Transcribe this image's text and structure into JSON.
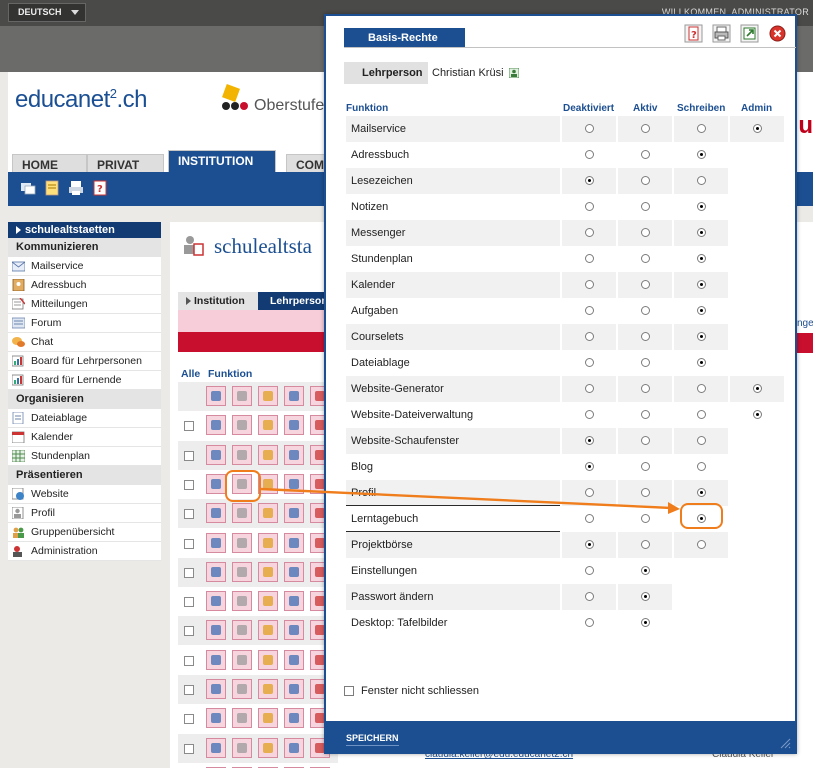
{
  "topbar": {
    "language": "DEUTSCH",
    "welcome": "WILLKOMMEN, ADMINISTRATOR"
  },
  "header": {
    "logo_main": "educanet",
    "logo_sup": "2",
    "logo_suffix": ".ch",
    "school": "Oberstufe",
    "edge_text": "u"
  },
  "nav": {
    "tabs": [
      "HOME",
      "PRIVAT",
      "INSTITUTION",
      "COM"
    ],
    "active": "INSTITUTION"
  },
  "sidebar": {
    "head": "schulealtstaetten",
    "sections": [
      {
        "title": "Kommunizieren",
        "items": [
          "Mailservice",
          "Adressbuch",
          "Mitteilungen",
          "Forum",
          "Chat",
          "Board für Lehrpersonen",
          "Board für Lernende"
        ]
      },
      {
        "title": "Organisieren",
        "items": [
          "Dateiablage",
          "Kalender",
          "Stundenplan"
        ]
      },
      {
        "title": "Präsentieren",
        "items": [
          "Website",
          "Profil",
          "Gruppenübersicht",
          "Administration"
        ]
      }
    ]
  },
  "main": {
    "title": "schulealtsta",
    "subtabs": [
      "Institution",
      "Lehrperson"
    ],
    "col_alle": "Alle",
    "col_funktion": "Funktion",
    "right_link": "ngen",
    "bottom_email": "claudia.keller@edu.educanet2.ch",
    "bottom_name": "Claudia Keller"
  },
  "modal": {
    "title": "Basis-Rechte",
    "lehrperson_label": "Lehrperson",
    "lehrperson_name": "Christian Krüsi",
    "columns": [
      "Funktion",
      "Deaktiviert",
      "Aktiv",
      "Schreiben",
      "Admin"
    ],
    "rows": [
      {
        "name": "Mailservice",
        "options": 4,
        "selected": "Admin"
      },
      {
        "name": "Adressbuch",
        "options": 3,
        "selected": "Schreiben"
      },
      {
        "name": "Lesezeichen",
        "options": 3,
        "selected": "Deaktiviert"
      },
      {
        "name": "Notizen",
        "options": 3,
        "selected": "Schreiben"
      },
      {
        "name": "Messenger",
        "options": 3,
        "selected": "Schreiben"
      },
      {
        "name": "Stundenplan",
        "options": 3,
        "selected": "Schreiben"
      },
      {
        "name": "Kalender",
        "options": 3,
        "selected": "Schreiben"
      },
      {
        "name": "Aufgaben",
        "options": 3,
        "selected": "Schreiben"
      },
      {
        "name": "Courselets",
        "options": 3,
        "selected": "Schreiben"
      },
      {
        "name": "Dateiablage",
        "options": 3,
        "selected": "Schreiben"
      },
      {
        "name": "Website-Generator",
        "options": 4,
        "selected": "Admin"
      },
      {
        "name": "Website-Dateiverwaltung",
        "options": 4,
        "selected": "Admin"
      },
      {
        "name": "Website-Schaufenster",
        "options": 3,
        "selected": "Deaktiviert"
      },
      {
        "name": "Blog",
        "options": 3,
        "selected": "Deaktiviert"
      },
      {
        "name": "Profil",
        "options": 3,
        "selected": "Schreiben"
      },
      {
        "name": "Lerntagebuch",
        "options": 3,
        "selected": "Schreiben"
      },
      {
        "name": "Projektbörse",
        "options": 3,
        "selected": "Deaktiviert"
      },
      {
        "name": "Einstellungen",
        "options": 2,
        "selected": "Aktiv"
      },
      {
        "name": "Passwort ändern",
        "options": 2,
        "selected": "Aktiv"
      },
      {
        "name": "Desktop: Tafelbilder",
        "options": 2,
        "selected": "Aktiv"
      }
    ],
    "checkbox_label": "Fenster nicht schliessen",
    "save_label": "SPEICHERN"
  },
  "colors": {
    "brand_blue": "#1c4f91",
    "dark_blue": "#123b73",
    "accent_red": "#c8102e",
    "highlight_orange": "#f07d1b"
  },
  "icons": {
    "help": "help-icon",
    "print": "printer-icon",
    "export": "export-icon",
    "close": "close-icon",
    "user": "user-icon"
  }
}
